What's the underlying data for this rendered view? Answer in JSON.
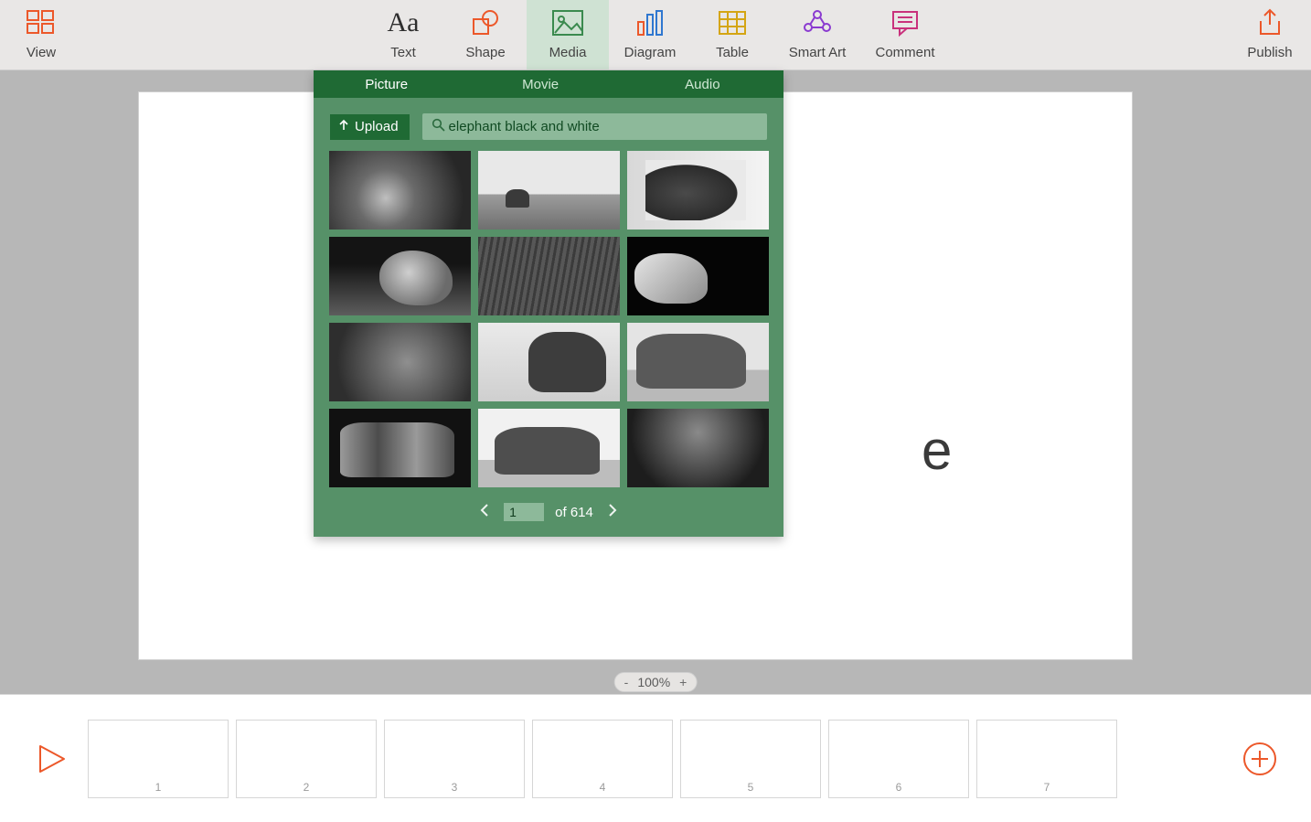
{
  "toolbar": {
    "view": "View",
    "text": "Text",
    "shape": "Shape",
    "media": "Media",
    "diagram": "Diagram",
    "table": "Table",
    "smart_art": "Smart Art",
    "comment": "Comment",
    "publish": "Publish"
  },
  "media_panel": {
    "tabs": {
      "picture": "Picture",
      "movie": "Movie",
      "audio": "Audio"
    },
    "upload_label": "Upload",
    "search_value": "elephant black and white",
    "search_placeholder": "Search",
    "page_current": "1",
    "page_of_label": "of 614"
  },
  "slide": {
    "title_peek": "e"
  },
  "zoom": {
    "minus": "-",
    "value": "100%",
    "plus": "+"
  },
  "strip": {
    "thumbs": [
      "1",
      "2",
      "3",
      "4",
      "5",
      "6",
      "7"
    ]
  }
}
